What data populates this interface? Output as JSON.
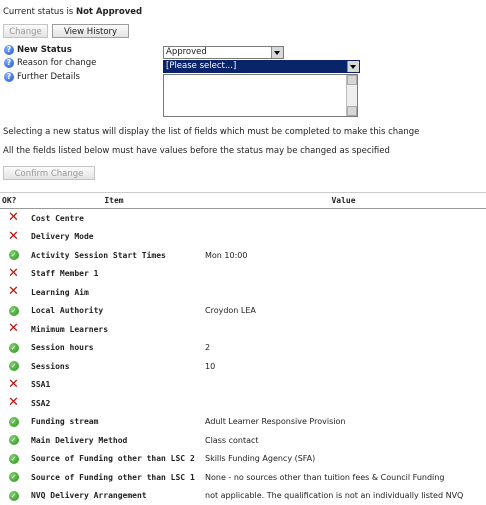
{
  "status": {
    "prefix": "Current status is ",
    "value": "Not Approved"
  },
  "buttons": {
    "change": "Change",
    "view_history": "View History",
    "confirm_change": "Confirm Change"
  },
  "form": {
    "new_status_label": "New Status",
    "new_status_value": "Approved",
    "reason_label": "Reason for change",
    "reason_value": "[Please select...]",
    "details_label": "Further Details"
  },
  "info": {
    "line1": "Selecting a new status will display the list of fields which must be completed to make this change",
    "line2": "All the fields listed below must have values before the status may be changed as specified"
  },
  "table": {
    "headers": {
      "ok": "OK?",
      "item": "Item",
      "value": "Value"
    },
    "rows": [
      {
        "ok": false,
        "item": "Cost Centre",
        "value": ""
      },
      {
        "ok": false,
        "item": "Delivery Mode",
        "value": ""
      },
      {
        "ok": true,
        "item": "Activity Session Start Times",
        "value": "Mon 10:00"
      },
      {
        "ok": false,
        "item": "Staff Member 1",
        "value": ""
      },
      {
        "ok": false,
        "item": "Learning Aim",
        "value": ""
      },
      {
        "ok": true,
        "item": "Local Authority",
        "value": "Croydon LEA"
      },
      {
        "ok": false,
        "item": "Minimum Learners",
        "value": ""
      },
      {
        "ok": true,
        "item": "Session hours",
        "value": "2"
      },
      {
        "ok": true,
        "item": "Sessions",
        "value": "10"
      },
      {
        "ok": false,
        "item": "SSA1",
        "value": ""
      },
      {
        "ok": false,
        "item": "SSA2",
        "value": ""
      },
      {
        "ok": true,
        "item": "Funding stream",
        "value": "Adult Learner Responsive Provision"
      },
      {
        "ok": true,
        "item": "Main Delivery Method",
        "value": "Class contact"
      },
      {
        "ok": true,
        "item": "Source of Funding other than LSC 2",
        "value": "Skills Funding Agency (SFA)"
      },
      {
        "ok": true,
        "item": "Source of Funding other than LSC 1",
        "value": "None - no sources other than tuition fees & Council Funding"
      },
      {
        "ok": true,
        "item": "NVQ Delivery Arrangement",
        "value": "not applicable. The qualification is not an individually listed NVQ"
      }
    ]
  }
}
